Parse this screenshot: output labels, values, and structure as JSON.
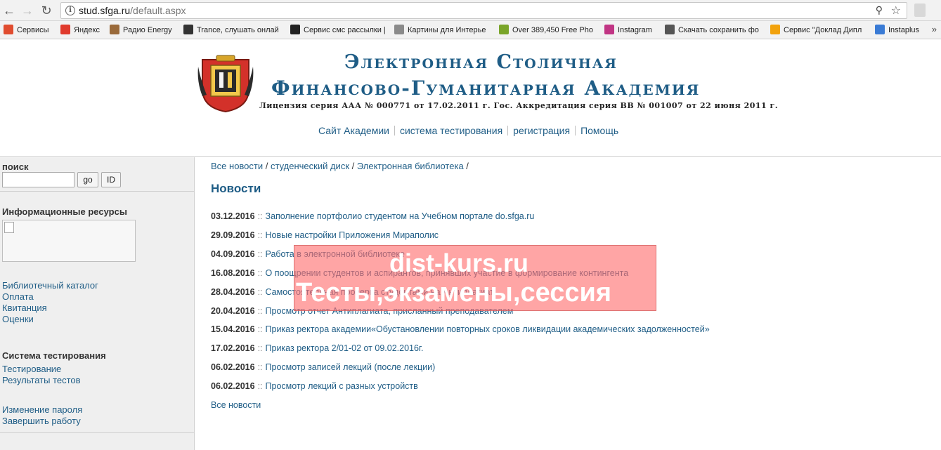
{
  "browser": {
    "url_host": "stud.sfga.ru",
    "url_path": "/default.aspx",
    "bookmarks": [
      {
        "label": "Сервисы",
        "icon": "apps-grid-icon",
        "color": "#e04c2f"
      },
      {
        "label": "Яндекс",
        "icon": "yandex-icon",
        "color": "#e03a2d"
      },
      {
        "label": "Радио Energy",
        "icon": "radio-icon",
        "color": "#9a6a3a"
      },
      {
        "label": "Trance, слушать онлай",
        "icon": "play-icon",
        "color": "#333333"
      },
      {
        "label": "Сервис смс рассылки |",
        "icon": "sms-icon",
        "color": "#222222"
      },
      {
        "label": "Картины для Интерье",
        "icon": "thumbs-up-icon",
        "color": "#8a8a8a"
      },
      {
        "label": "Over 389,450 Free Pho",
        "icon": "photo-icon",
        "color": "#7aa52a"
      },
      {
        "label": "Instagram",
        "icon": "instagram-icon",
        "color": "#c13584"
      },
      {
        "label": "Скачать сохранить фо",
        "icon": "eye-icon",
        "color": "#555555"
      },
      {
        "label": "Сервис \"Доклад Дипл",
        "icon": "pacman-icon",
        "color": "#f2a20c"
      },
      {
        "label": "Instaplus",
        "icon": "instaplus-icon",
        "color": "#3a7bd5"
      }
    ]
  },
  "header": {
    "title_line1": "Электронная Столичная",
    "title_line2": "Финансово-Гуманитарная Академия",
    "license": "Лицензия серия ААА № 000771 от 17.02.2011 г. Гос. Аккредитация  серия ВВ № 001007 от 22 июня 2011 г.",
    "nav": [
      "Сайт Академии",
      "система тестирования",
      "регистрация",
      "Помощь"
    ]
  },
  "sidebar": {
    "search_heading": "поиск",
    "search_value": "",
    "go_label": "go",
    "id_label": "ID",
    "resources_heading": "Информационные ресурсы",
    "resource_links": [
      "Библиотечный каталог",
      "Оплата",
      "Квитанция",
      "Оценки"
    ],
    "testing_heading": "Система тестирования",
    "testing_links": [
      "Тестирование",
      "Результаты тестов"
    ],
    "account_links": [
      "Изменение пароля",
      "Завершить работу"
    ]
  },
  "main": {
    "breadcrumbs": [
      "Все новости",
      "студенческий диск",
      "Электронная библиотека"
    ],
    "news_heading": "Новости",
    "separator": "::",
    "news": [
      {
        "date": "03.12.2016",
        "title": "Заполнение портфолио студентом на Учебном портале do.sfga.ru"
      },
      {
        "date": "29.09.2016",
        "title": "Новые настройки Приложения Мираполис"
      },
      {
        "date": "04.09.2016",
        "title": "Работа в электронной библиотеке"
      },
      {
        "date": "16.08.2016",
        "title": "О поощрении студентов и аспирантов, принявших участие в формирование контингента"
      },
      {
        "date": "28.04.2016",
        "title": "Самостоятельная проверка студентами на Антиплагиат"
      },
      {
        "date": "20.04.2016",
        "title": "Просмотр отчет Антиплагиата, присланный преподавателем"
      },
      {
        "date": "15.04.2016",
        "title": "Приказ ректора академии«Обустановлении повторных сроков ликвидации академических задолженностей»"
      },
      {
        "date": "17.02.2016",
        "title": "Приказ ректора 2/01-02 от 09.02.2016г."
      },
      {
        "date": "06.02.2016",
        "title": "Просмотр записей лекций (после лекции)"
      },
      {
        "date": "06.02.2016",
        "title": "Просмотр лекций с разных устройств"
      }
    ],
    "all_news": "Все новости"
  },
  "watermark": {
    "line1": "dist-kurs.ru",
    "line2": "Тесты,экзамены,сессия"
  }
}
